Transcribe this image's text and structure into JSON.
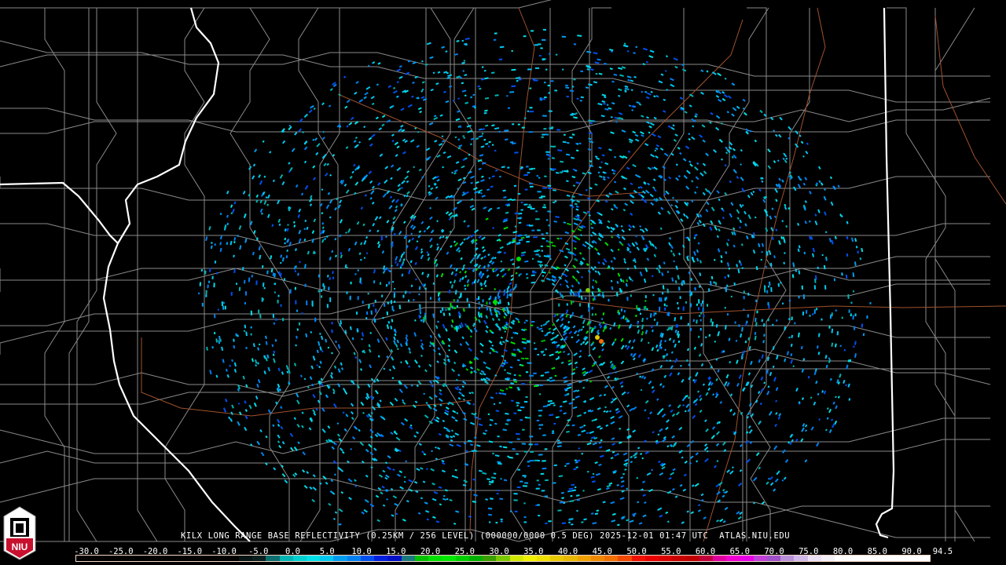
{
  "product": {
    "title": "KILX LONG RANGE BASE REFLECTIVITY (0.25KM / 256 LEVEL) (000000/0000 0.5 DEG) 2025-12-01 01:47 UTC  ATLAS.NIU.EDU"
  },
  "logo": {
    "text": "NIU",
    "brand_color": "#c8102e"
  },
  "legend": {
    "unit_range": [
      -30.0,
      94.5
    ],
    "ticks": [
      "-30.0",
      "-25.0",
      "-20.0",
      "-15.0",
      "-10.0",
      "-5.0",
      "0.0",
      "5.0",
      "10.0",
      "15.0",
      "20.0",
      "25.0",
      "30.0",
      "35.0",
      "40.0",
      "45.0",
      "50.0",
      "55.0",
      "60.0",
      "65.0",
      "70.0",
      "75.0",
      "80.0",
      "85.0",
      "90.0",
      "94.5"
    ],
    "colors": [
      "#000000",
      "#000000",
      "#000000",
      "#000000",
      "#000000",
      "#000000",
      "#000000",
      "#000000",
      "#000000",
      "#000000",
      "#000000",
      "#000000",
      "#061414",
      "#0a2020",
      "#0d6e6e",
      "#00b4b4",
      "#00d0d0",
      "#00e0e8",
      "#00c8f0",
      "#009cf0",
      "#0080f0",
      "#0050f0",
      "#0020e0",
      "#0010c8",
      "#1a7a80",
      "#00c000",
      "#00e000",
      "#00e800",
      "#00d000",
      "#00b000",
      "#3a9e00",
      "#7ac800",
      "#d0e800",
      "#f0f000",
      "#f0e000",
      "#e8c800",
      "#e8b800",
      "#f0a000",
      "#f08800",
      "#f07000",
      "#f04800",
      "#f01000",
      "#e80000",
      "#d80000",
      "#c80000",
      "#c00000",
      "#c0003c",
      "#e000a0",
      "#f000d0",
      "#e800e8",
      "#c040d8",
      "#a050c8",
      "#b890d8",
      "#d0b8e8",
      "#ece0f4",
      "#f4f0f8",
      "#ffffff",
      "#ffffff",
      "#ffffff",
      "#ffffff",
      "#ffffff",
      "#ffffff",
      "#ffffff"
    ]
  },
  "radar": {
    "site": "KILX"
  }
}
